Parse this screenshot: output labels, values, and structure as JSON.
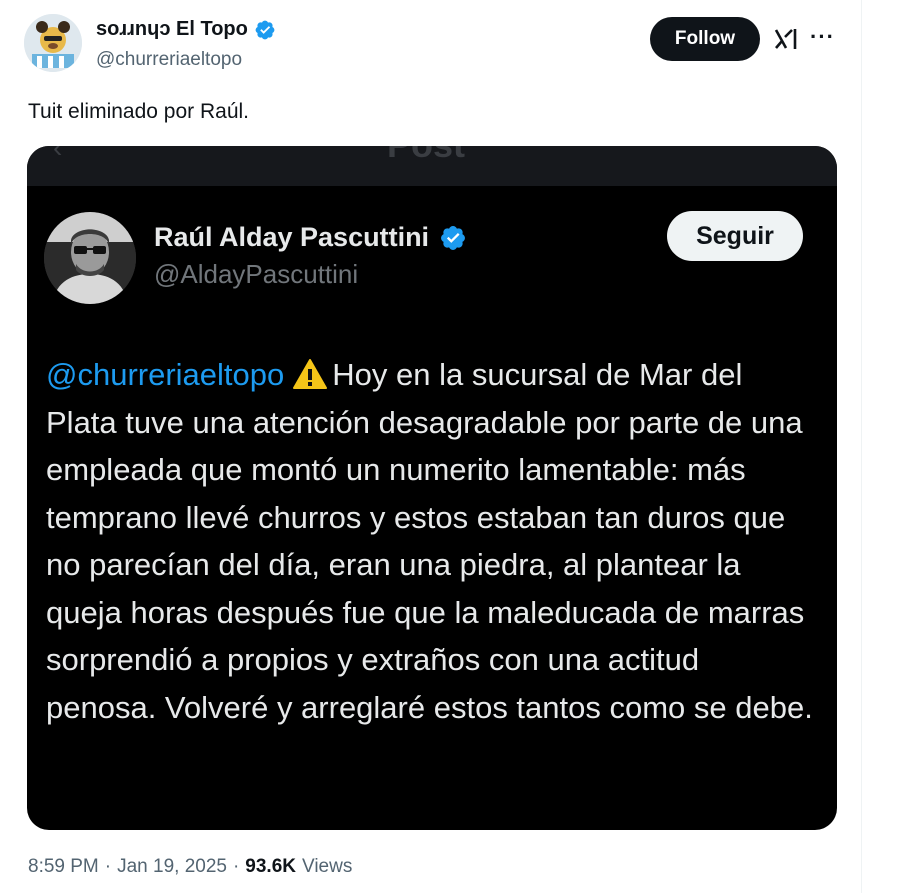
{
  "author": {
    "display_name": "soɹɹnɥɔ El Topo",
    "handle": "@churreriaeltopo",
    "verified": true
  },
  "header": {
    "follow_label": "Follow",
    "x_logo_icon": "x-grok-icon",
    "more_label": "···"
  },
  "tweet": {
    "text": "Tuit eliminado por Raúl."
  },
  "embedded": {
    "topbar_label": "Post",
    "author": {
      "display_name": "Raúl Alday Pascuttini",
      "handle": "@AldayPascuttini",
      "verified": true
    },
    "follow_label": "Seguir",
    "mention": "@churreriaeltopo",
    "warning_icon": "warning-icon",
    "body": "Hoy en la sucursal de Mar del Plata tuve una atención desagradable por parte de una empleada que montó un numerito lamentable: más temprano llevé churros y estos estaban tan duros que no parecían del día, eran una piedra, al plantear la queja horas después fue que la maleducada de marras sorprendió a propios y extraños con una actitud penosa. Volveré y arreglaré estos tantos como se debe."
  },
  "meta": {
    "time": "8:59 PM",
    "separator": "·",
    "date": "Jan 19, 2025",
    "views_count": "93.6K",
    "views_label": "Views"
  },
  "colors": {
    "accent": "#1d9bf0",
    "follow_bg": "#0f1419",
    "embedded_bg": "#000000"
  }
}
